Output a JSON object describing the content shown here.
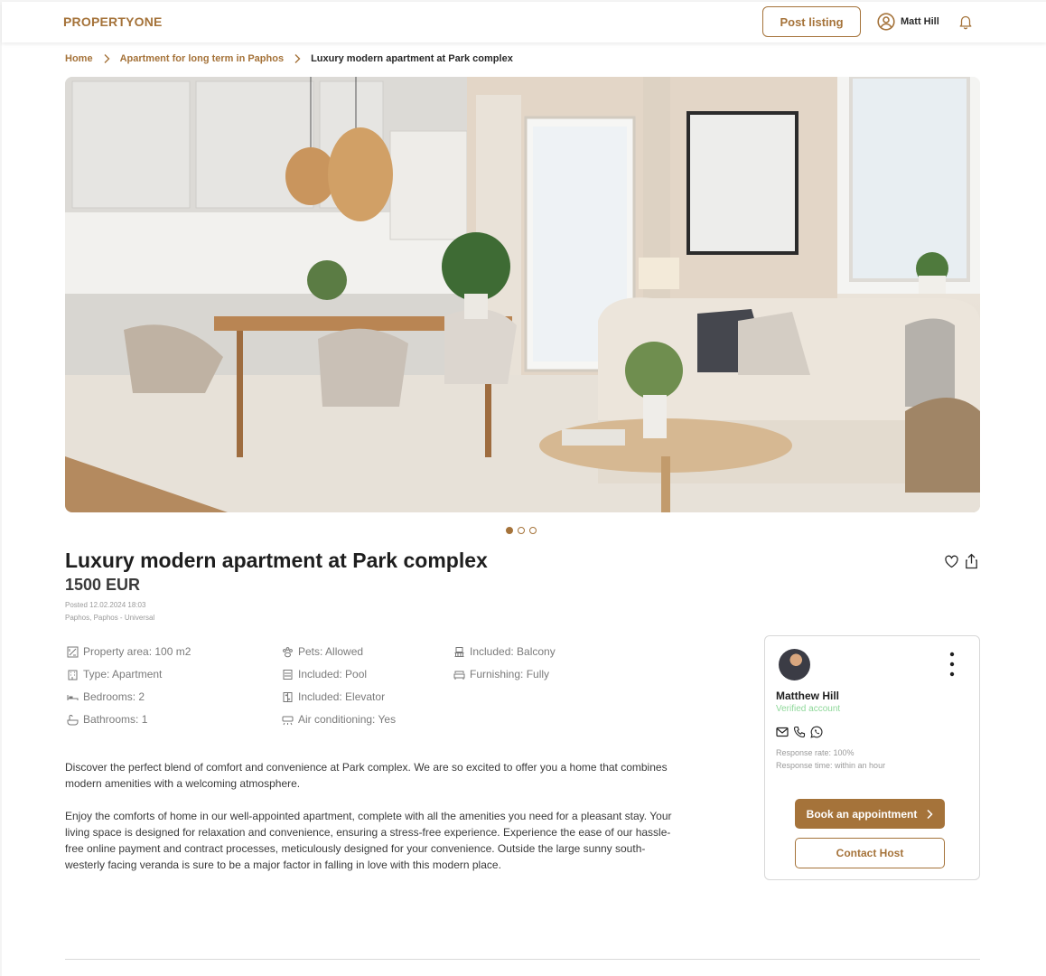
{
  "header": {
    "logo": "PROPERTYONE",
    "post_listing": "Post listing",
    "user_name": "Matt Hill"
  },
  "breadcrumb": {
    "home": "Home",
    "category": "Apartment for long term in Paphos",
    "current": "Luxury modern apartment at Park complex"
  },
  "gallery": {
    "slides": 3,
    "active_slide": 1
  },
  "listing": {
    "title": "Luxury modern apartment at Park complex",
    "price": "1500 EUR",
    "posted": "Posted 12.02.2024 18:03",
    "location": "Paphos, Paphos - Universal"
  },
  "features": [
    {
      "icon": "area-icon",
      "label": "Property area: 100 m2"
    },
    {
      "icon": "building-icon",
      "label": "Type: Apartment"
    },
    {
      "icon": "bed-icon",
      "label": "Bedrooms: 2"
    },
    {
      "icon": "bath-icon",
      "label": "Bathrooms: 1"
    },
    {
      "icon": "paw-icon",
      "label": "Pets: Allowed"
    },
    {
      "icon": "pool-icon",
      "label": "Included: Pool"
    },
    {
      "icon": "elevator-icon",
      "label": "Included: Elevator"
    },
    {
      "icon": "ac-icon",
      "label": "Air conditioning: Yes"
    },
    {
      "icon": "balcony-icon",
      "label": "Included: Balcony"
    },
    {
      "icon": "sofa-icon",
      "label": "Furnishing: Fully"
    }
  ],
  "description": {
    "p1": "Discover the perfect blend of comfort and convenience at Park complex. We are so excited to offer you a home that combines modern amenities with a welcoming atmosphere.",
    "p2": "Enjoy the comforts of home in our well-appointed apartment, complete with all the amenities you need for a pleasant stay. Your living space is designed for relaxation and convenience, ensuring a stress-free experience. Experience the ease of our hassle-free online payment and contract processes, meticulously designed for your convenience. Outside the large sunny south-westerly facing veranda is sure to be a major factor in falling in love with this modern place."
  },
  "host": {
    "name": "Matthew Hill",
    "status": "Verified account",
    "response_rate": "Response rate: 100%",
    "response_time": "Response time: within an hour",
    "book_label": "Book an appointment",
    "contact_label": "Contact Host"
  },
  "colors": {
    "brand": "#a5733a",
    "verified": "#8fd89a",
    "muted_text": "#9a9a9a"
  }
}
